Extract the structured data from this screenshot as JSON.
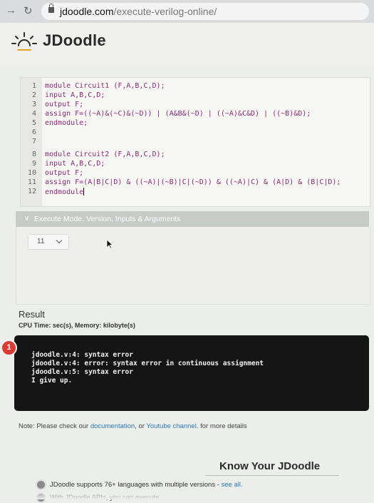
{
  "browser": {
    "url_domain": "jdoodle.com",
    "url_path": "/execute-verilog-online/"
  },
  "header": {
    "logo_text": "JDoodle"
  },
  "editor": {
    "lines": [
      {
        "num": "1",
        "code": "module Circuit1 (F,A,B,C,D);"
      },
      {
        "num": "2",
        "code": "input A,B,C,D;"
      },
      {
        "num": "3",
        "code": "output F;"
      },
      {
        "num": "4",
        "code": "assign F=((~A)&(~C)&(~D)) | (A&B&(~D) | ((~A)&C&D) | ((~B)&D);"
      },
      {
        "num": "5",
        "code": "endmodule;"
      },
      {
        "num": "6",
        "code": ""
      },
      {
        "num": "7",
        "code": ""
      },
      {
        "num": "8",
        "code": "module Circuit2 (F,A,B,C,D);"
      },
      {
        "num": "9",
        "code": "input A,B,C,D;"
      },
      {
        "num": "10",
        "code": "output F;"
      },
      {
        "num": "11",
        "code": "assign F=(A|B|C|D) & ((~A)|(~B)|C|(~D)) & ((~A)|C) & (A|D) & (B|C|D);"
      },
      {
        "num": "12",
        "code": "endmodule"
      }
    ]
  },
  "execute": {
    "toggle_label": "Execute Mode, Version, Inputs & Arguments",
    "version_value": "11"
  },
  "result": {
    "title": "Result",
    "meta": "CPU Time: sec(s), Memory: kilobyte(s)",
    "badge": "1",
    "output_lines": [
      "jdoodle.v:4: syntax error",
      "jdoodle.v:4: error: syntax error in continuous assignment",
      "jdoodle.v:5: syntax error",
      "I give up."
    ]
  },
  "note": {
    "prefix": "Note: Please check our ",
    "link1": "documentation",
    "middle": ", or ",
    "link2": "Youtube channel",
    "suffix": ". for more details"
  },
  "know": {
    "title": "Know Your JDoodle",
    "bullet1_text": "JDoodle supports 76+ languages with multiple versions - ",
    "bullet1_link": "see all.",
    "bullet2_text": "With JDoodle APIs, you can execute..."
  }
}
